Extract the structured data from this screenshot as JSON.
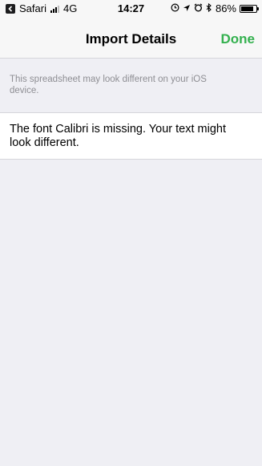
{
  "status_bar": {
    "back_app_label": "Safari",
    "network": "4G",
    "time": "14:27",
    "battery_percent_label": "86%",
    "battery_level": 0.86,
    "icons": [
      "back-arrow-icon",
      "signal-icon",
      "location-lock-icon",
      "location-icon",
      "alarm-icon",
      "bluetooth-icon",
      "battery-icon"
    ]
  },
  "nav": {
    "title": "Import Details",
    "done_label": "Done"
  },
  "notice": {
    "text": "This spreadsheet may look different on your iOS device."
  },
  "warnings": [
    {
      "text": "The font Calibri is missing. Your text might look different."
    }
  ],
  "colors": {
    "accent": "#34b14f",
    "background": "#efeff4",
    "secondary_text": "#8e8e93"
  }
}
